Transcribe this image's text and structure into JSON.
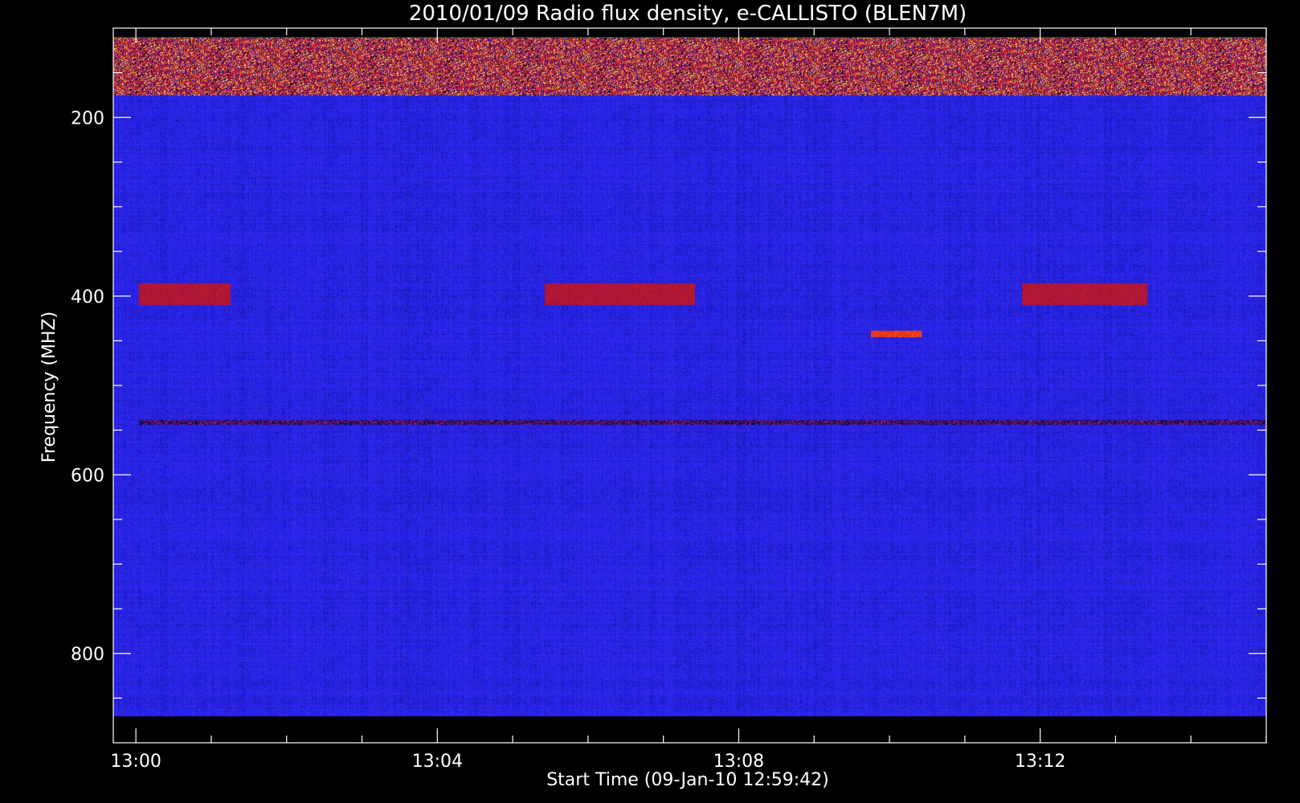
{
  "chart_data": {
    "type": "heatmap",
    "title": "2010/01/09  Radio flux density, e-CALLISTO (BLEN7M)",
    "xlabel": "Start Time (09-Jan-10 12:59:42)",
    "ylabel": "Frequency (MHZ)",
    "x_axis": {
      "unit": "time",
      "range": [
        "12:59:42",
        "13:15:00"
      ],
      "data_start": "12:59:42",
      "data_end": "13:15:00",
      "major_ticks": [
        "13:00",
        "13:04",
        "13:08",
        "13:12"
      ],
      "minor_tick_interval_minutes": 1
    },
    "y_axis": {
      "unit": "MHz",
      "range": [
        100,
        900
      ],
      "inverted": true,
      "data_range": [
        110,
        870
      ],
      "major_ticks": [
        200,
        400,
        600,
        800
      ],
      "minor_tick_interval": 50
    },
    "colormap": {
      "name": "blue-red-yellow",
      "stops": [
        "#000000",
        "#1a1ae6",
        "#3b2ff0",
        "#7a1a8c",
        "#a01010",
        "#ff2010",
        "#ffe020",
        "#ffffff"
      ]
    },
    "background_level": "blue",
    "features": [
      {
        "kind": "interference band",
        "freq": [
          110,
          175
        ],
        "intensity": "high, sporadic yellow/red"
      },
      {
        "kind": "red block",
        "freq": [
          385,
          410
        ],
        "time": [
          "13:00:02",
          "13:01:15"
        ],
        "intensity": "red"
      },
      {
        "kind": "red block",
        "freq": [
          385,
          410
        ],
        "time": [
          "13:05:25",
          "13:07:25"
        ],
        "intensity": "red"
      },
      {
        "kind": "red block",
        "freq": [
          385,
          410
        ],
        "time": [
          "13:11:45",
          "13:13:25"
        ],
        "intensity": "red"
      },
      {
        "kind": "red streak",
        "freq": [
          438,
          446
        ],
        "time": [
          "13:09:45",
          "13:10:25"
        ],
        "intensity": "bright red"
      },
      {
        "kind": "dark line",
        "freq": [
          538,
          544
        ],
        "time": [
          "13:00:02",
          "13:15:00"
        ],
        "intensity": "dark"
      }
    ]
  }
}
